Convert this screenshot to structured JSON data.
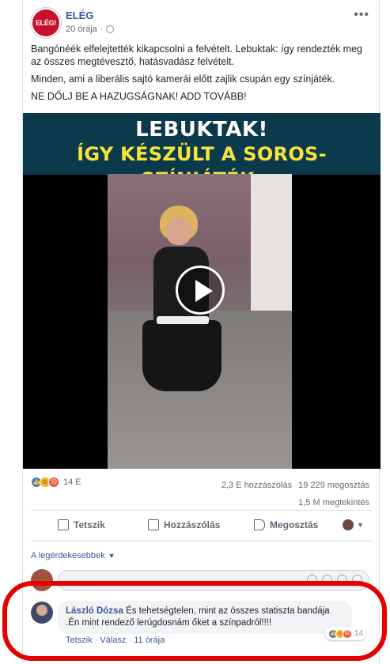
{
  "post": {
    "page_name": "ELÉG",
    "avatar_text": "ELÉG!",
    "time": "20 órája",
    "more_icon": "more-horizontal-icon",
    "text": [
      "Bangónéék elfelejtették kikapcsolni a felvételt. Lebuktak: így rendezték meg az összes megtévesztő, hatásvadász felvételt.",
      "Minden, ami a liberális sajtó kamerái előtt zajlik csupán egy színjáték.",
      "NE DŐLJ BE A HAZUGSÁGNAK! ADD TOVÁBB!"
    ]
  },
  "video": {
    "banner_line1": "LEBUKTAK!",
    "banner_line2": "ÍGY KÉSZÜLT A SOROS-SZÍNJÁTÉK:",
    "play_icon": "play-icon",
    "colors": {
      "banner_bg": "#0b3a4c",
      "line1": "#ffffff",
      "line2": "#f7e33a"
    }
  },
  "stats": {
    "reaction_count": "14 E",
    "comments": "2,3 E hozzászólás",
    "shares": "19 229 megosztás",
    "views": "1,5 M megtekintés"
  },
  "actions": {
    "like": "Tetszik",
    "comment": "Hozzászólás",
    "share": "Megosztás"
  },
  "comments_filter": "A legérdekesebbek",
  "comment": {
    "author": "László Dózsa",
    "text": "És tehetségtelen, mint az összes statiszta bandája .Én mint rendező lerúgdosnám őket a színpadról!!!!",
    "reaction_count": "14",
    "like_link": "Tetszik",
    "reply_link": "Válasz",
    "time": "11 órája",
    "separator": "·"
  },
  "highlight_color": "#e60000"
}
